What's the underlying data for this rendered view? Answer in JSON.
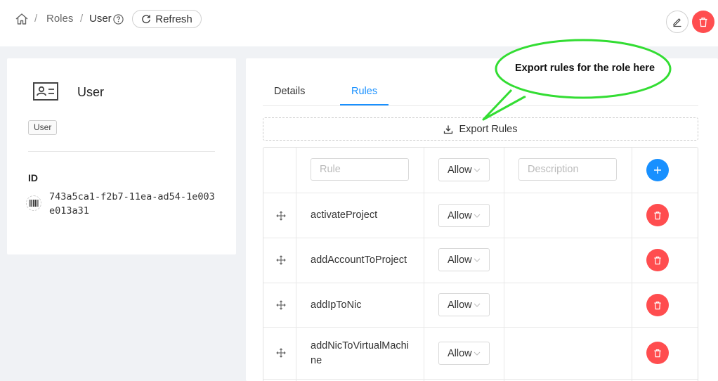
{
  "breadcrumb": {
    "roles_label": "Roles",
    "current_label": "User",
    "separator": "/"
  },
  "header": {
    "refresh_label": "Refresh"
  },
  "role_card": {
    "title": "User",
    "tag": "User",
    "id_label": "ID",
    "id_value": "743a5ca1-f2b7-11ea-ad54-1e003e013a31"
  },
  "tabs": [
    {
      "label": "Details",
      "active": false
    },
    {
      "label": "Rules",
      "active": true
    }
  ],
  "export_label": "Export Rules",
  "new_rule_row": {
    "rule_placeholder": "Rule",
    "permission": "Allow",
    "description_placeholder": "Description"
  },
  "rules": [
    {
      "name": "activateProject",
      "permission": "Allow"
    },
    {
      "name": "addAccountToProject",
      "permission": "Allow"
    },
    {
      "name": "addIpToNic",
      "permission": "Allow"
    },
    {
      "name": "addNicToVirtualMachine",
      "permission": "Allow"
    }
  ],
  "callout": {
    "text": "Export rules for the role here"
  },
  "colors": {
    "primary": "#1890ff",
    "danger": "#ff4d4f",
    "callout_border": "#33dd33"
  }
}
